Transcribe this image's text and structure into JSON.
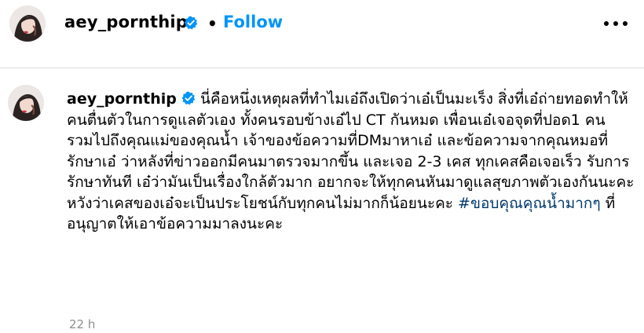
{
  "header": {
    "username": "aey_pornthip",
    "separator": "•",
    "follow_label": "Follow",
    "more_icon": "more-horizontal-icon",
    "verified_icon": "verified-badge-icon"
  },
  "comment": {
    "username": "aey_pornthip",
    "text_before_hashtag": "นี่คือหนึ่งเหตุผลที่ทำไมเอ๋ถึงเปิดว่าเอ๋เป็นมะเร็ง สิ่งที่เอ๋ถ่ายทอดทำให้คนตื่นตัวในการดูแลตัวเอง ทั้งคนรอบข้างเอ๋ไป CT กันหมด เพื่อนเอ๋เจอจุดที่ปอด1 คน รวมไปถึงคุณแม่ของคุณน้ำ เจ้าของข้อความที่DMมาหาเอ๋ และข้อความจากคุณหมอที่รักษาเอ๋ ว่าหลังที่ข่าวออกมีคนมาตรวจมากขึ้น และเจอ 2-3 เคส ทุกเคสคือเจอเร็ว รับการรักษาทันที เอ๋ว่ามันเป็นเรื่องใกล้ตัวมาก อยากจะให้ทุกคนหันมาดูแลสุขภาพตัวเองกันนะคะ หวังว่าเคสของเอ๋จะเป็นประโยชน์กับทุกคนไม่มากก็น้อยนะคะ",
    "hashtag": "#ขอบคุณคุณน้ำมากๆ",
    "text_after_hashtag": "ที่อนุญาตให้เอาข้อความมาลงนะคะ",
    "time": "22 h"
  },
  "colors": {
    "accent": "#0095f6",
    "hashtag": "#00376b",
    "muted": "#8e8e8e",
    "divider": "#dbdbdb"
  }
}
